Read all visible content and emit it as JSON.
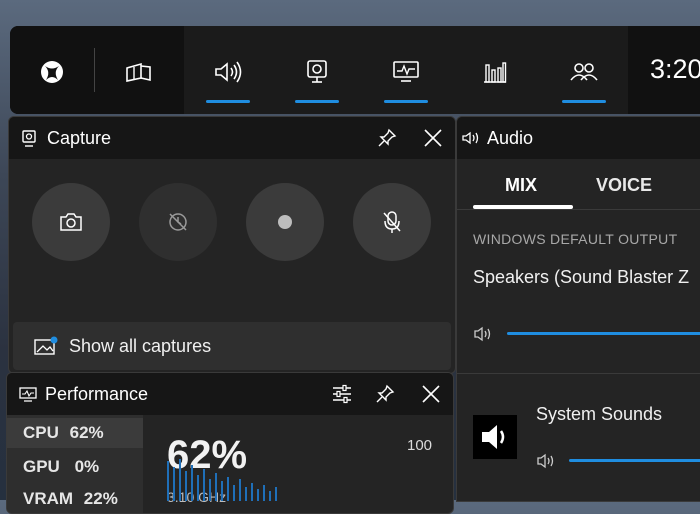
{
  "topbar": {
    "time": "3:20",
    "buttons": [
      {
        "name": "xbox-button",
        "icon": "xbox-logo-icon"
      },
      {
        "name": "widget-menu-button",
        "icon": "widget-menu-icon"
      },
      {
        "name": "audio-widget-button",
        "icon": "speaker-icon"
      },
      {
        "name": "capture-widget-button",
        "icon": "webcam-icon"
      },
      {
        "name": "performance-widget-button",
        "icon": "monitor-chart-icon"
      },
      {
        "name": "resources-widget-button",
        "icon": "bar-chart-icon"
      },
      {
        "name": "social-widget-button",
        "icon": "people-icon"
      }
    ]
  },
  "capture": {
    "title": "Capture",
    "show_all": "Show all captures"
  },
  "audio": {
    "title": "Audio",
    "tabs": [
      "MIX",
      "VOICE"
    ],
    "section_label": "WINDOWS DEFAULT OUTPUT",
    "device": "Speakers (Sound Blaster Z",
    "app": "System Sounds"
  },
  "performance": {
    "title": "Performance",
    "rows": [
      {
        "label": "CPU",
        "value": "62%"
      },
      {
        "label": "GPU",
        "value": "0%"
      },
      {
        "label": "VRAM",
        "value": "22%"
      }
    ],
    "big_value": "62%",
    "max_label": "100",
    "sub_text": "3.10 GHz"
  },
  "colors": {
    "accent": "#1f8de0",
    "panel": "#242424",
    "header": "#161616"
  }
}
